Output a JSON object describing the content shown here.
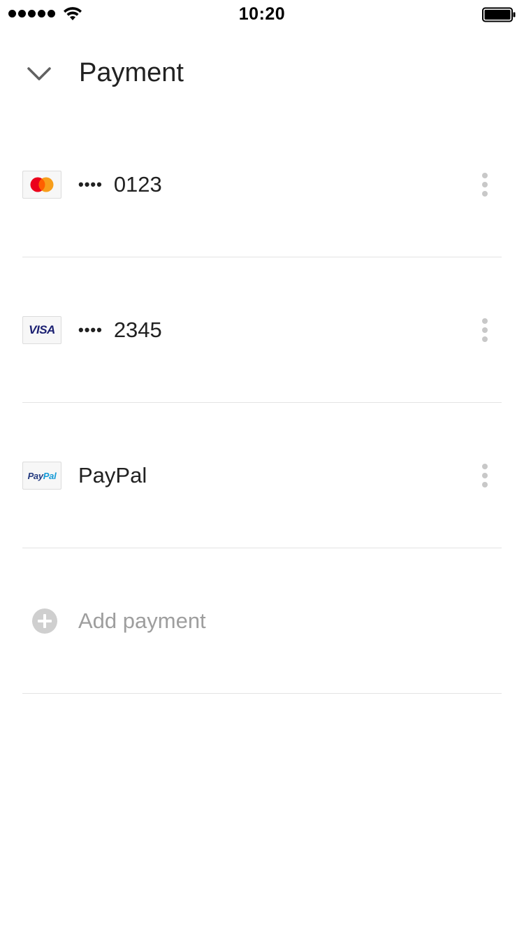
{
  "status_bar": {
    "time": "10:20",
    "signal_icon": "signal-dots-icon",
    "wifi_icon": "wifi-icon",
    "battery_icon": "battery-full-icon"
  },
  "header": {
    "title": "Payment",
    "collapse_icon": "chevron-down-icon"
  },
  "payments": [
    {
      "brand": "Mastercard",
      "logo_icon": "mastercard-logo-icon",
      "mask": "••••",
      "last4": "0123",
      "menu_icon": "more-vertical-icon"
    },
    {
      "brand": "Visa",
      "logo_icon": "visa-logo-icon",
      "logo_text": "VISA",
      "mask": "••••",
      "last4": "2345",
      "menu_icon": "more-vertical-icon"
    },
    {
      "brand": "PayPal",
      "logo_icon": "paypal-logo-icon",
      "logo_text_pay": "Pay",
      "logo_text_pal": "Pal",
      "label": "PayPal",
      "menu_icon": "more-vertical-icon"
    }
  ],
  "add_payment": {
    "label": "Add payment",
    "icon": "add-circle-icon"
  },
  "colors": {
    "text_primary": "#212121",
    "text_muted": "#9e9e9e",
    "divider": "#e3e3e3",
    "icon_muted": "#c8c8c8",
    "mastercard_red": "#eb001b",
    "mastercard_orange": "#f79e1b",
    "visa_blue": "#1a1f71"
  }
}
